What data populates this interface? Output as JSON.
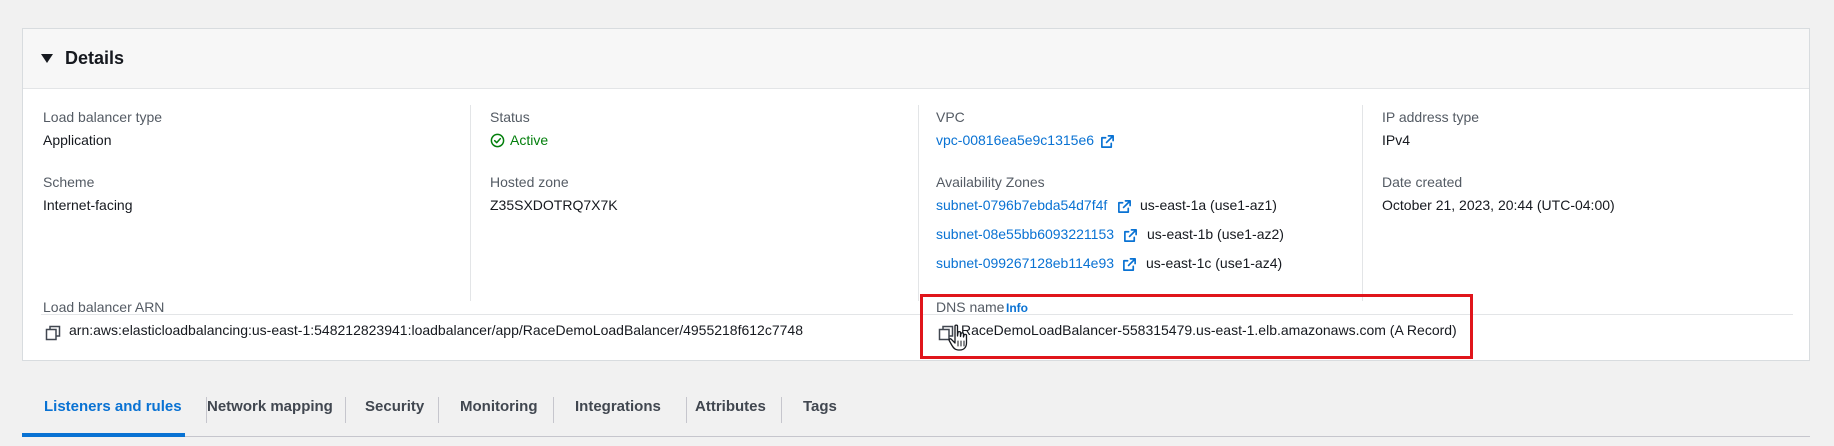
{
  "details": {
    "title": "Details",
    "load_balancer_type": {
      "label": "Load balancer type",
      "value": "Application"
    },
    "scheme": {
      "label": "Scheme",
      "value": "Internet-facing"
    },
    "status": {
      "label": "Status",
      "value": "Active"
    },
    "hosted_zone": {
      "label": "Hosted zone",
      "value": "Z35SXDOTRQ7X7K"
    },
    "vpc": {
      "label": "VPC",
      "value": "vpc-00816ea5e9c1315e6"
    },
    "availability_zones": {
      "label": "Availability Zones",
      "items": [
        {
          "subnet": "subnet-0796b7ebda54d7f4f",
          "zone": "us-east-1a (use1-az1)"
        },
        {
          "subnet": "subnet-08e55bb6093221153",
          "zone": "us-east-1b (use1-az2)"
        },
        {
          "subnet": "subnet-099267128eb114e93",
          "zone": "us-east-1c (use1-az4)"
        }
      ]
    },
    "ip_address_type": {
      "label": "IP address type",
      "value": "IPv4"
    },
    "date_created": {
      "label": "Date created",
      "value": "October 21, 2023, 20:44 (UTC-04:00)"
    },
    "arn": {
      "label": "Load balancer ARN",
      "value": "arn:aws:elasticloadbalancing:us-east-1:548212823941:loadbalancer/app/RaceDemoLoadBalancer/4955218f612c7748"
    },
    "dns": {
      "label": "DNS name",
      "info": "Info",
      "value": "RaceDemoLoadBalancer-558315479.us-east-1.elb.amazonaws.com (A Record)"
    }
  },
  "tabs": [
    {
      "label": "Listeners and rules",
      "active": true
    },
    {
      "label": "Network mapping",
      "active": false
    },
    {
      "label": "Security",
      "active": false
    },
    {
      "label": "Monitoring",
      "active": false
    },
    {
      "label": "Integrations",
      "active": false
    },
    {
      "label": "Attributes",
      "active": false
    },
    {
      "label": "Tags",
      "active": false
    }
  ],
  "colors": {
    "link": "#0972d3",
    "status_active": "#037f0c",
    "highlight": "#e0151b"
  }
}
